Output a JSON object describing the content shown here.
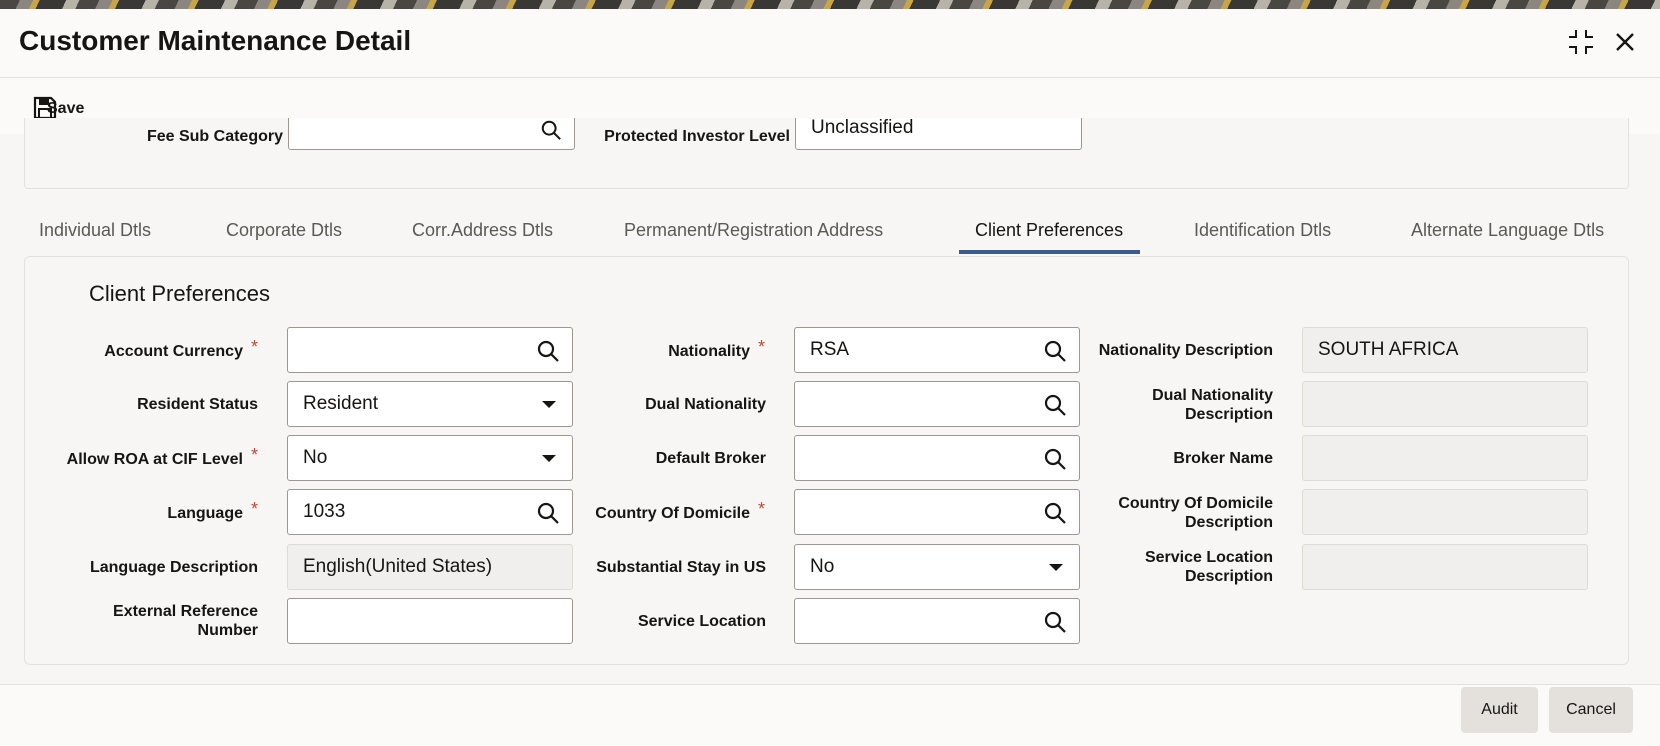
{
  "window": {
    "title": "Customer Maintenance Detail"
  },
  "toolbar": {
    "save_label": "Save"
  },
  "upper": {
    "fee_sub_category_label": "Fee Sub Category",
    "protected_investor_label": "Protected Investor Level",
    "protected_investor_value": "Unclassified"
  },
  "tabs": [
    {
      "label": "Individual Dtls"
    },
    {
      "label": "Corporate Dtls"
    },
    {
      "label": "Corr.Address Dtls"
    },
    {
      "label": "Permanent/Registration Address"
    },
    {
      "label": "Client Preferences"
    },
    {
      "label": "Identification Dtls"
    },
    {
      "label": "Alternate Language Dtls"
    }
  ],
  "section": {
    "title": "Client Preferences"
  },
  "form": {
    "account_currency": {
      "label": "Account Currency",
      "value": "",
      "required": "*"
    },
    "resident_status": {
      "label": "Resident Status",
      "value": "Resident"
    },
    "allow_roa": {
      "label": "Allow ROA at CIF Level",
      "value": "No",
      "required": "*"
    },
    "language": {
      "label": "Language",
      "value": "1033",
      "required": "*"
    },
    "language_description": {
      "label": "Language Description",
      "value": "English(United States)"
    },
    "external_reference": {
      "label_line1": "External Reference",
      "label_line2": "Number",
      "value": ""
    },
    "nationality": {
      "label": "Nationality",
      "value": "RSA",
      "required": "*"
    },
    "dual_nationality": {
      "label": "Dual Nationality",
      "value": ""
    },
    "default_broker": {
      "label": "Default Broker",
      "value": ""
    },
    "country_of_domicile": {
      "label": "Country Of Domicile",
      "value": "",
      "required": "*"
    },
    "substantial_stay": {
      "label": "Substantial Stay in US",
      "value": "No"
    },
    "service_location": {
      "label": "Service Location",
      "value": ""
    },
    "nationality_description": {
      "label": "Nationality Description",
      "value": "SOUTH AFRICA"
    },
    "dual_nationality_description": {
      "label_line1": "Dual Nationality",
      "label_line2": "Description",
      "value": ""
    },
    "broker_name": {
      "label": "Broker Name",
      "value": ""
    },
    "country_of_domicile_description": {
      "label_line1": "Country Of Domicile",
      "label_line2": "Description",
      "value": ""
    },
    "service_location_description": {
      "label_line1": "Service Location",
      "label_line2": "Description",
      "value": ""
    }
  },
  "footer": {
    "audit_label": "Audit",
    "cancel_label": "Cancel"
  },
  "colors": {
    "accent": "#3b5b8c",
    "required": "#c74634",
    "panel": "#f7f6f4"
  }
}
